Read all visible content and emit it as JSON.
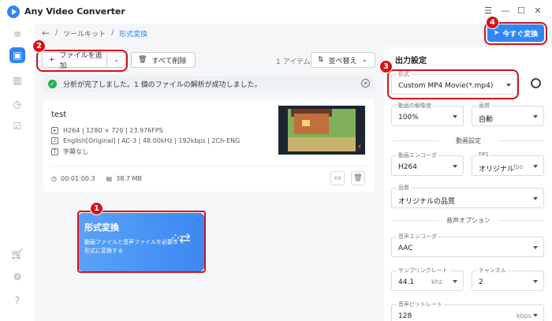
{
  "app": {
    "title": "Any Video Converter"
  },
  "window": {
    "menu_icon": "menu-icon",
    "min": "minimize-icon",
    "max": "maximize-icon",
    "close": "close-icon"
  },
  "breadcrumb": {
    "root": "ツールキット",
    "current": "形式変換"
  },
  "toolbar": {
    "add_label": "ファイルを追加",
    "clear_label": "すべて削除",
    "count_label": "1 アイテム",
    "sort_label": "並べ替え"
  },
  "status": {
    "message": "分析が完了しました。1 個のファイルの解析が成功しました。"
  },
  "file": {
    "name": "test",
    "video_info": "H264 | 1280 × 720 | 23.976FPS",
    "audio_info": "English[Original] | AC-3 | 48.00kHz | 192kbps | 2Ch-ENG",
    "subtitle_info": "字幕なし",
    "duration": "00:01:00.3",
    "size": "38.7 MB"
  },
  "banner": {
    "title": "形式変換",
    "desc": "動画ファイルと音声ファイルを必要な形式に変換する"
  },
  "convert_button": {
    "label": "今すぐ変換"
  },
  "panel": {
    "title": "出力設定",
    "format_label": "形式",
    "format_value": "Custom MP4 Movie(*.mp4)",
    "resolution_label": "動画の解像度",
    "resolution_value": "100%",
    "quality_label": "画質",
    "quality_value": "自動",
    "video_section": "動画設定",
    "encoder_label": "動画エンコーダ",
    "encoder_value": "H264",
    "fps_label": "FPS",
    "fps_value": "オリジナル",
    "fps_unit": "fps",
    "vquality_label": "品質",
    "vquality_value": "オリジナルの品質",
    "audio_section": "音声オプション",
    "aencoder_label": "音声エンコーダ",
    "aencoder_value": "AAC",
    "sample_label": "サンプリングレート",
    "sample_value": "44.1",
    "sample_unit": "khz",
    "channel_label": "チャンネル",
    "channel_value": "2",
    "bitrate_label": "音声ビットレート",
    "bitrate_value": "128",
    "bitrate_unit": "kbps"
  },
  "badges": [
    "1",
    "2",
    "3",
    "4"
  ],
  "colors": {
    "accent": "#2f86f6",
    "highlight": "#d4121a",
    "success": "#22b14c"
  }
}
